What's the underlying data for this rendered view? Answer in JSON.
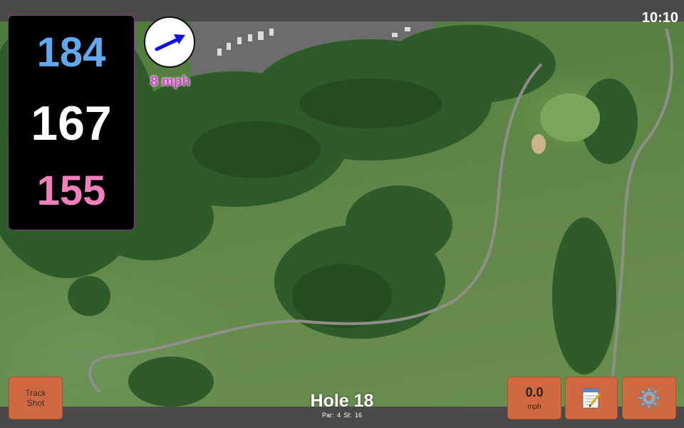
{
  "status": {
    "time": "10:10"
  },
  "distances": {
    "back": "184",
    "middle": "167",
    "front": "155"
  },
  "wind": {
    "speed_label": "8 mph",
    "arrow_icon": "wind-direction-arrow-icon",
    "arrow_color": "#1010e0"
  },
  "hole": {
    "title": "Hole 18",
    "par": "Par: 4",
    "stroke_index": "SI: 16"
  },
  "buttons": {
    "track_shot": "Track Shot",
    "wind_value": "0.0",
    "wind_unit": "mph",
    "notes_icon": "notepad-icon",
    "settings_icon": "gear-icon"
  },
  "colors": {
    "back": "#5fa8f0",
    "middle": "#ffffff",
    "front": "#ef80bd",
    "button": "#d06840",
    "wind_text": "#e13ad1"
  }
}
